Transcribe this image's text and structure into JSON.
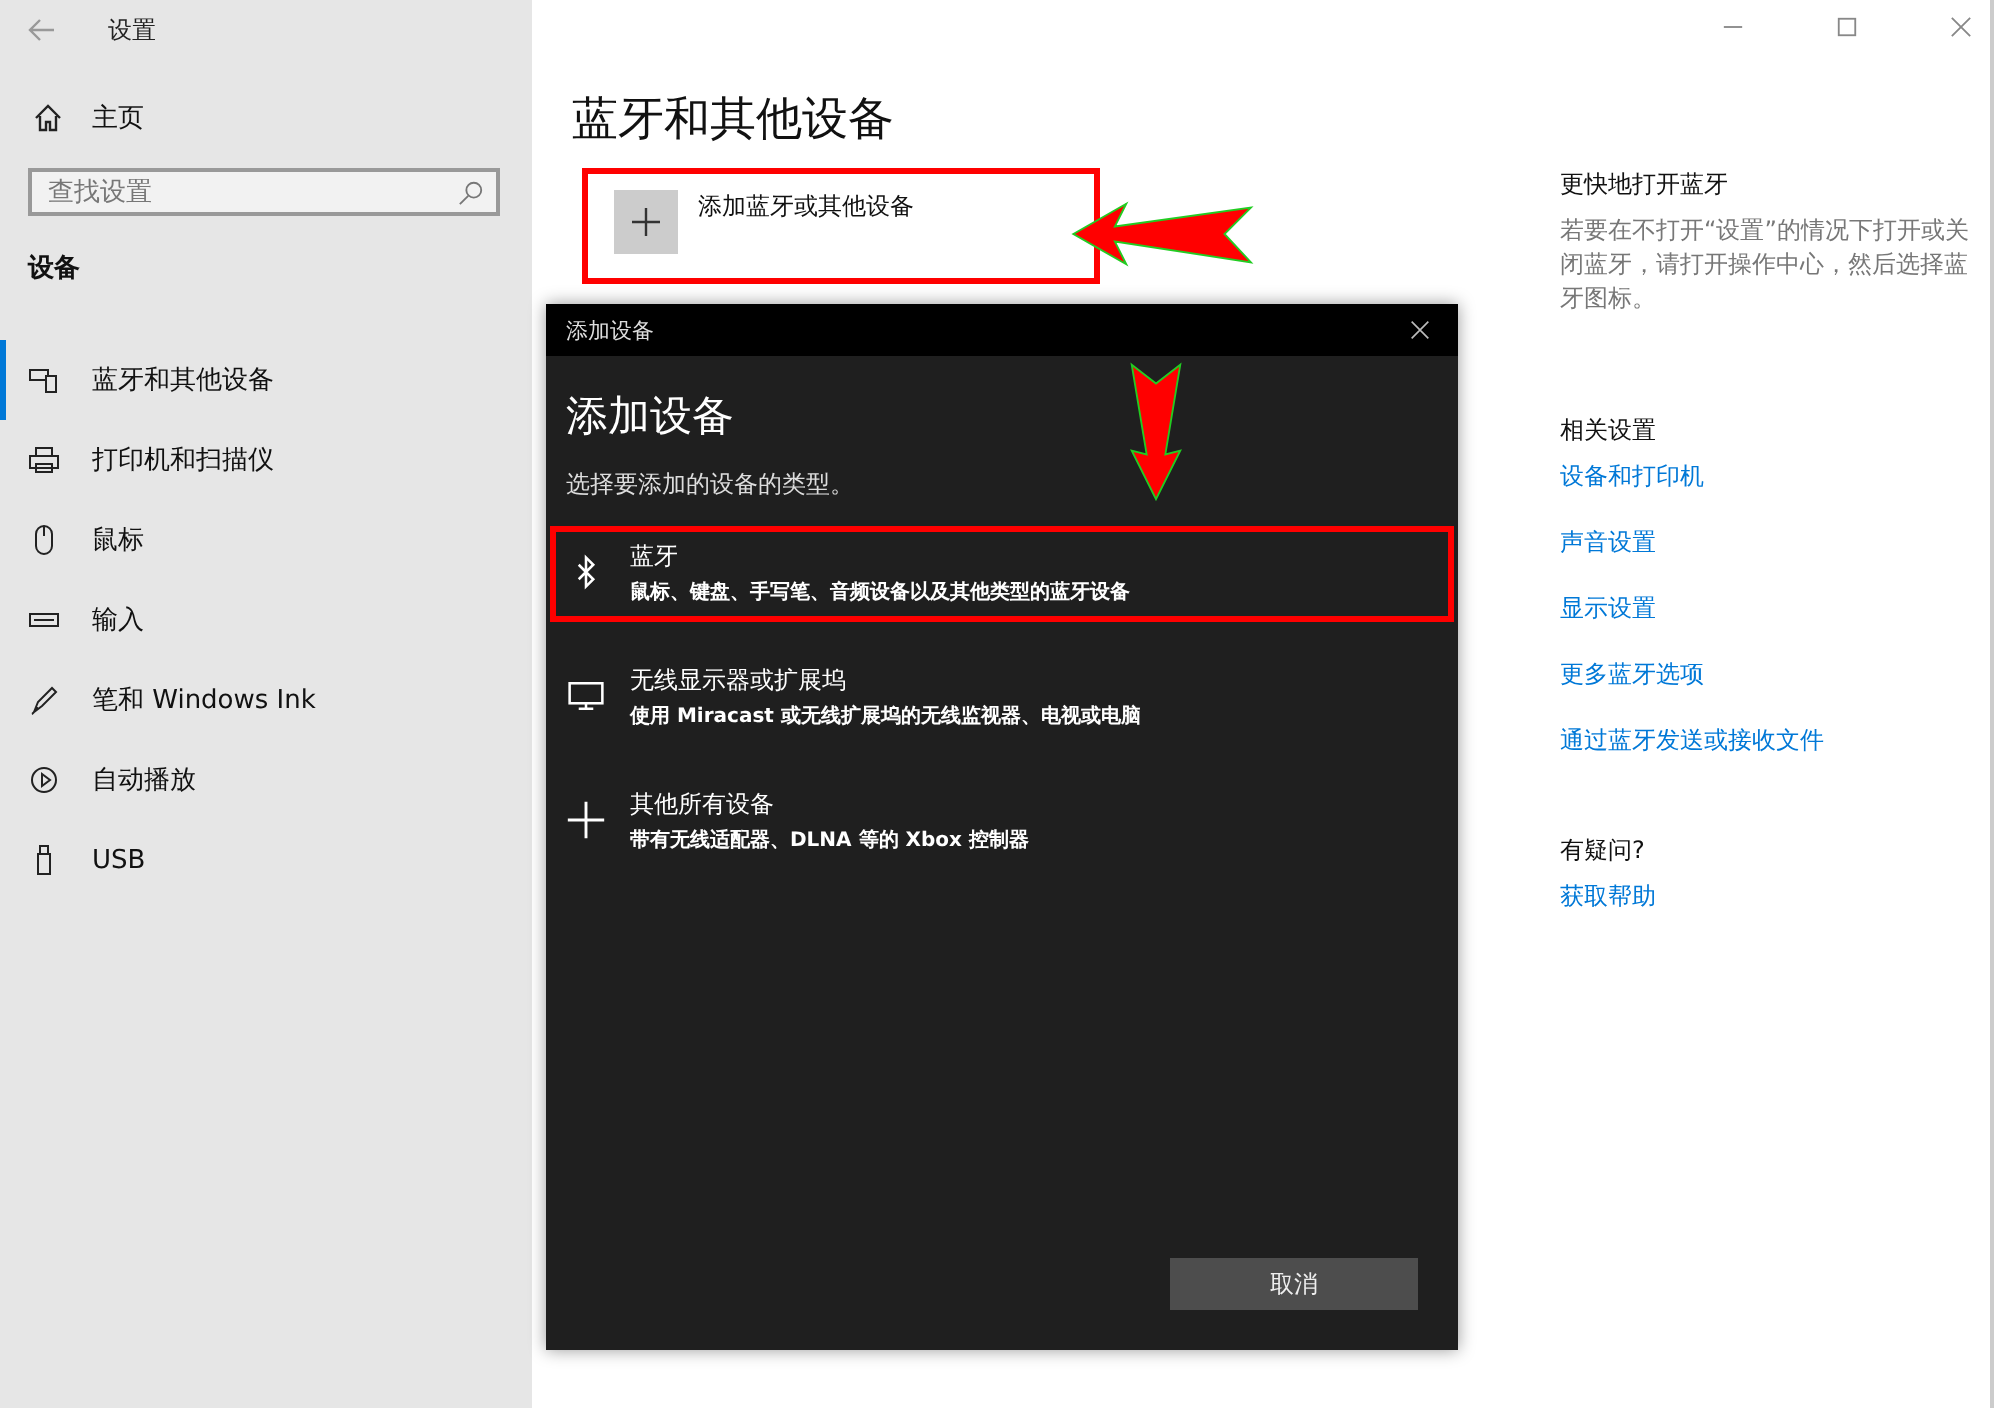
{
  "window": {
    "title": "设置"
  },
  "sidebar": {
    "home": "主页",
    "search": {
      "placeholder": "查找设置"
    },
    "section": "设备",
    "items": [
      {
        "label": "蓝牙和其他设备",
        "kind": "devices",
        "selected": true
      },
      {
        "label": "打印机和扫描仪",
        "kind": "printer",
        "selected": false
      },
      {
        "label": "鼠标",
        "kind": "mouse",
        "selected": false
      },
      {
        "label": "输入",
        "kind": "keyboard",
        "selected": false
      },
      {
        "label": "笔和 Windows Ink",
        "kind": "pen",
        "selected": false
      },
      {
        "label": "自动播放",
        "kind": "autoplay",
        "selected": false
      },
      {
        "label": "USB",
        "kind": "usb",
        "selected": false
      }
    ]
  },
  "main": {
    "title": "蓝牙和其他设备",
    "add_button": {
      "label": "添加蓝牙或其他设备",
      "highlighted": true
    }
  },
  "right": {
    "quick": {
      "title": "更快地打开蓝牙",
      "text": "若要在不打开“设置”的情况下打开或关闭蓝牙，请打开操作中心，然后选择蓝牙图标。"
    },
    "related": {
      "title": "相关设置",
      "links": [
        "设备和打印机",
        "声音设置",
        "显示设置",
        "更多蓝牙选项",
        "通过蓝牙发送或接收文件"
      ]
    },
    "help": {
      "title": "有疑问?",
      "links": [
        "获取帮助"
      ]
    }
  },
  "dialog": {
    "title": "添加设备",
    "heading": "添加设备",
    "subtitle": "选择要添加的设备的类型。",
    "options": [
      {
        "kind": "bluetooth",
        "title": "蓝牙",
        "description": "鼠标、键盘、手写笔、音频设备以及其他类型的蓝牙设备",
        "highlighted": true
      },
      {
        "kind": "display",
        "title": "无线显示器或扩展坞",
        "description": "使用 Miracast 或无线扩展坞的无线监视器、电视或电脑",
        "highlighted": false
      },
      {
        "kind": "plus",
        "title": "其他所有设备",
        "description": "带有无线适配器、DLNA 等的 Xbox 控制器",
        "highlighted": false
      }
    ],
    "cancel": "取消"
  }
}
